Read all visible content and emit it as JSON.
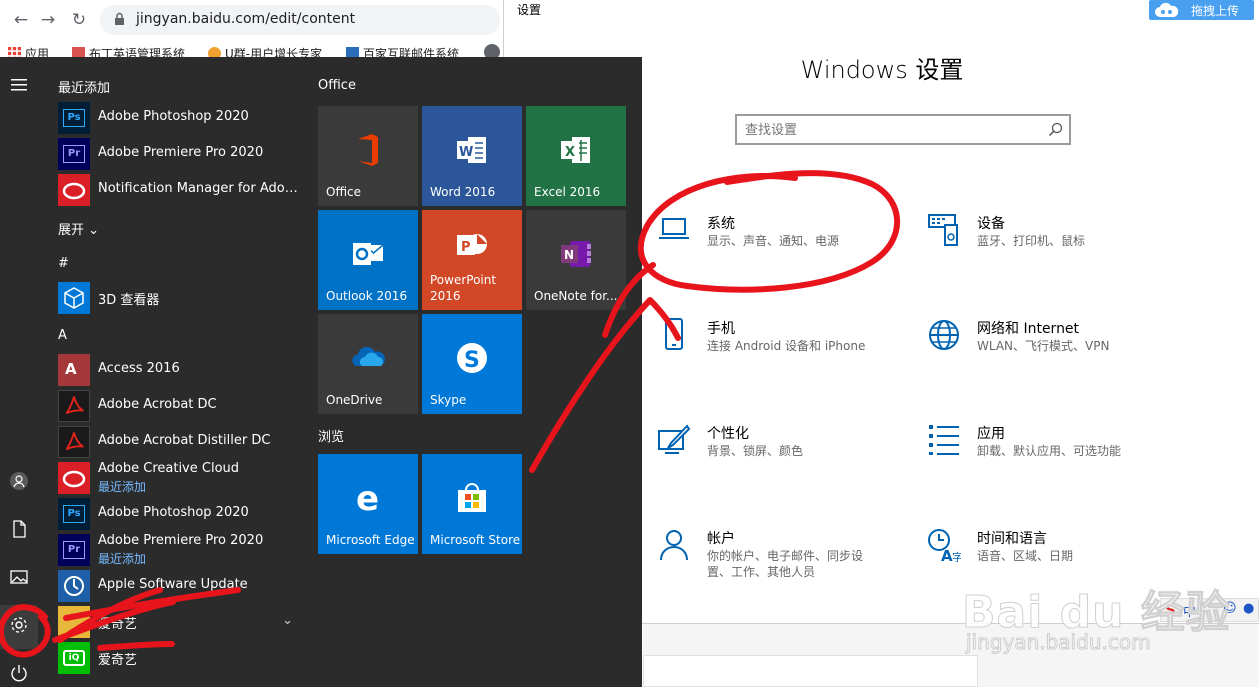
{
  "browser": {
    "url": "jingyan.baidu.com/edit/content",
    "bookmarks": [
      "应用",
      "布丁英语管理系统",
      "U群-用户增长专家",
      "百家互联邮件系统"
    ]
  },
  "settings_window": {
    "title": "设置",
    "heading": "Windows 设置",
    "search_placeholder": "查找设置",
    "categories": [
      {
        "title": "系统",
        "desc": "显示、声音、通知、电源",
        "icon": "laptop-icon"
      },
      {
        "title": "设备",
        "desc": "蓝牙、打印机、鼠标",
        "icon": "devices-icon"
      },
      {
        "title": "手机",
        "desc": "连接 Android 设备和 iPhone",
        "icon": "phone-icon"
      },
      {
        "title": "网络和 Internet",
        "desc": "WLAN、飞行模式、VPN",
        "icon": "globe-icon"
      },
      {
        "title": "个性化",
        "desc": "背景、锁屏、颜色",
        "icon": "personalize-icon"
      },
      {
        "title": "应用",
        "desc": "卸载、默认应用、可选功能",
        "icon": "apps-list-icon"
      },
      {
        "title": "帐户",
        "desc": "你的帐户、电子邮件、同步设置、工作、其他人员",
        "icon": "person-icon"
      },
      {
        "title": "时间和语言",
        "desc": "语音、区域、日期",
        "icon": "time-language-icon"
      }
    ]
  },
  "upload_button": {
    "label": "拖拽上传"
  },
  "ime": {
    "mode": "中",
    "punct": "°,"
  },
  "start_menu": {
    "recent_header": "最近添加",
    "expand_label": "展开",
    "section_hash": "#",
    "section_a": "A",
    "recent_apps": [
      {
        "name": "Adobe Photoshop 2020",
        "icon": "photoshop-icon"
      },
      {
        "name": "Adobe Premiere Pro 2020",
        "icon": "premiere-icon"
      },
      {
        "name": "Notification Manager for Adobe...",
        "icon": "creative-cloud-icon"
      }
    ],
    "hash_apps": [
      {
        "name": "3D 查看器",
        "icon": "3d-viewer-icon"
      }
    ],
    "a_apps": [
      {
        "name": "Access 2016",
        "sub": "",
        "icon": "access-icon"
      },
      {
        "name": "Adobe Acrobat DC",
        "sub": "",
        "icon": "acrobat-icon"
      },
      {
        "name": "Adobe Acrobat Distiller DC",
        "sub": "",
        "icon": "distiller-icon"
      },
      {
        "name": "Adobe Creative Cloud",
        "sub": "最近添加",
        "icon": "creative-cloud-icon"
      },
      {
        "name": "Adobe Photoshop 2020",
        "sub": "",
        "icon": "photoshop-icon"
      },
      {
        "name": "Adobe Premiere Pro 2020",
        "sub": "最近添加",
        "icon": "premiere-icon"
      },
      {
        "name": "Apple Software Update",
        "sub": "",
        "icon": "apple-update-icon"
      },
      {
        "name": "爱奇艺",
        "sub": "",
        "icon": "folder-icon"
      },
      {
        "name": "爱奇艺",
        "sub": "",
        "icon": "iqiyi-icon"
      }
    ],
    "group_office": "Office",
    "group_browse": "浏览",
    "tiles": [
      {
        "label": "Office",
        "color": "#3a3a3a",
        "icon": "office-icon"
      },
      {
        "label": "Word 2016",
        "color": "#2b579a",
        "icon": "word-icon"
      },
      {
        "label": "Excel 2016",
        "color": "#217346",
        "icon": "excel-icon"
      },
      {
        "label": "Outlook 2016",
        "color": "#0072c6",
        "icon": "outlook-icon"
      },
      {
        "label": "PowerPoint\n2016",
        "color": "#d24726",
        "icon": "powerpoint-icon"
      },
      {
        "label": "OneNote for...",
        "color": "#3a3a3a",
        "icon": "onenote-icon"
      },
      {
        "label": "OneDrive",
        "color": "#3a3a3a",
        "icon": "onedrive-icon"
      },
      {
        "label": "Skype",
        "color": "#0078d7",
        "icon": "skype-icon"
      },
      {
        "label": "Microsoft Edge",
        "color": "#0078d7",
        "icon": "edge-icon"
      },
      {
        "label": "Microsoft Store",
        "color": "#0078d7",
        "icon": "store-icon"
      }
    ]
  },
  "watermark": {
    "brand": "Bai du 经验",
    "url": "jingyan.baidu.com"
  },
  "accent_color": "#0078d7",
  "annotation_color": "#e8141c"
}
